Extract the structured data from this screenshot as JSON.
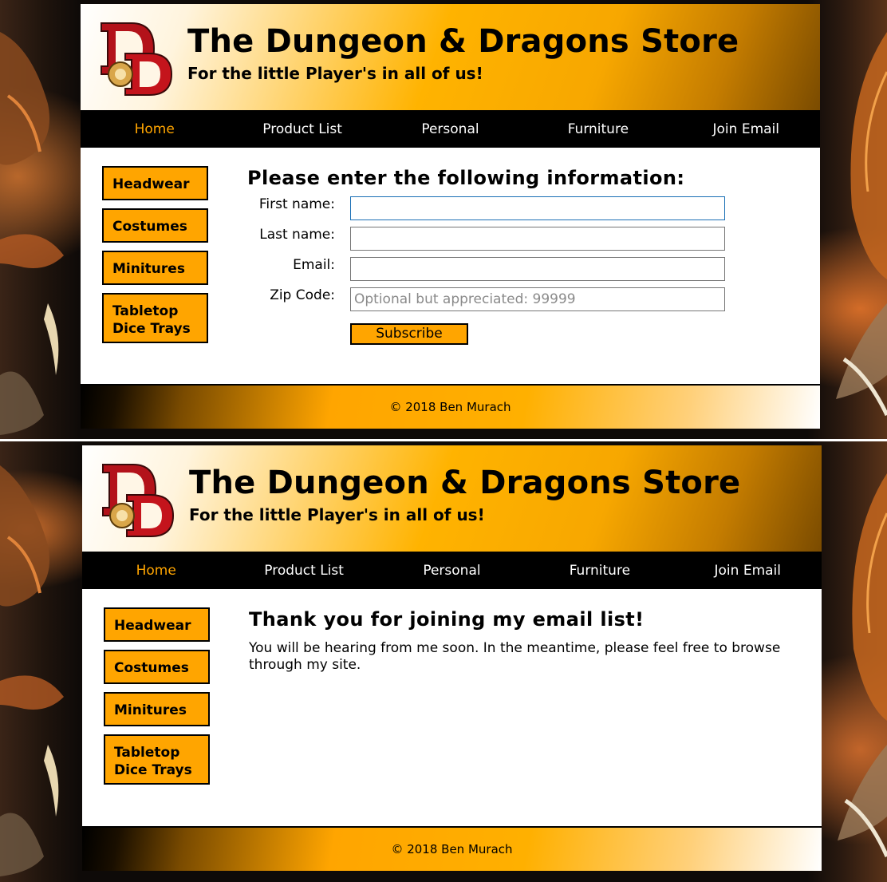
{
  "site": {
    "title": "The Dungeon & Dragons Store",
    "subtitle": "For the little Player's in all of us!",
    "footer": "© 2018 Ben Murach"
  },
  "nav": {
    "items": [
      "Home",
      "Product List",
      "Personal",
      "Furniture",
      "Join Email"
    ],
    "active": "Home"
  },
  "sidebar": {
    "items": [
      {
        "line1": "Headwear",
        "line2": ""
      },
      {
        "line1": "Costumes",
        "line2": ""
      },
      {
        "line1": "Minitures",
        "line2": ""
      },
      {
        "line1": "Tabletop",
        "line2": "Dice Trays"
      }
    ]
  },
  "form_screen": {
    "heading": "Please enter the following information:",
    "first_name_label": "First name:",
    "first_name_value": "",
    "last_name_label": "Last name:",
    "last_name_value": "",
    "email_label": "Email:",
    "email_value": "",
    "zip_label": "Zip Code:",
    "zip_placeholder": "Optional but appreciated: 99999",
    "subscribe_label": "Subscribe"
  },
  "thanks_screen": {
    "heading": "Thank you for joining my email list!",
    "message": "You will be hearing from me soon. In the meantime, please feel free to browse through my site."
  },
  "colors": {
    "accent": "#ffa500",
    "nav_bg": "#000000",
    "nav_active": "#ffa500",
    "nav_text": "#ffffff"
  }
}
